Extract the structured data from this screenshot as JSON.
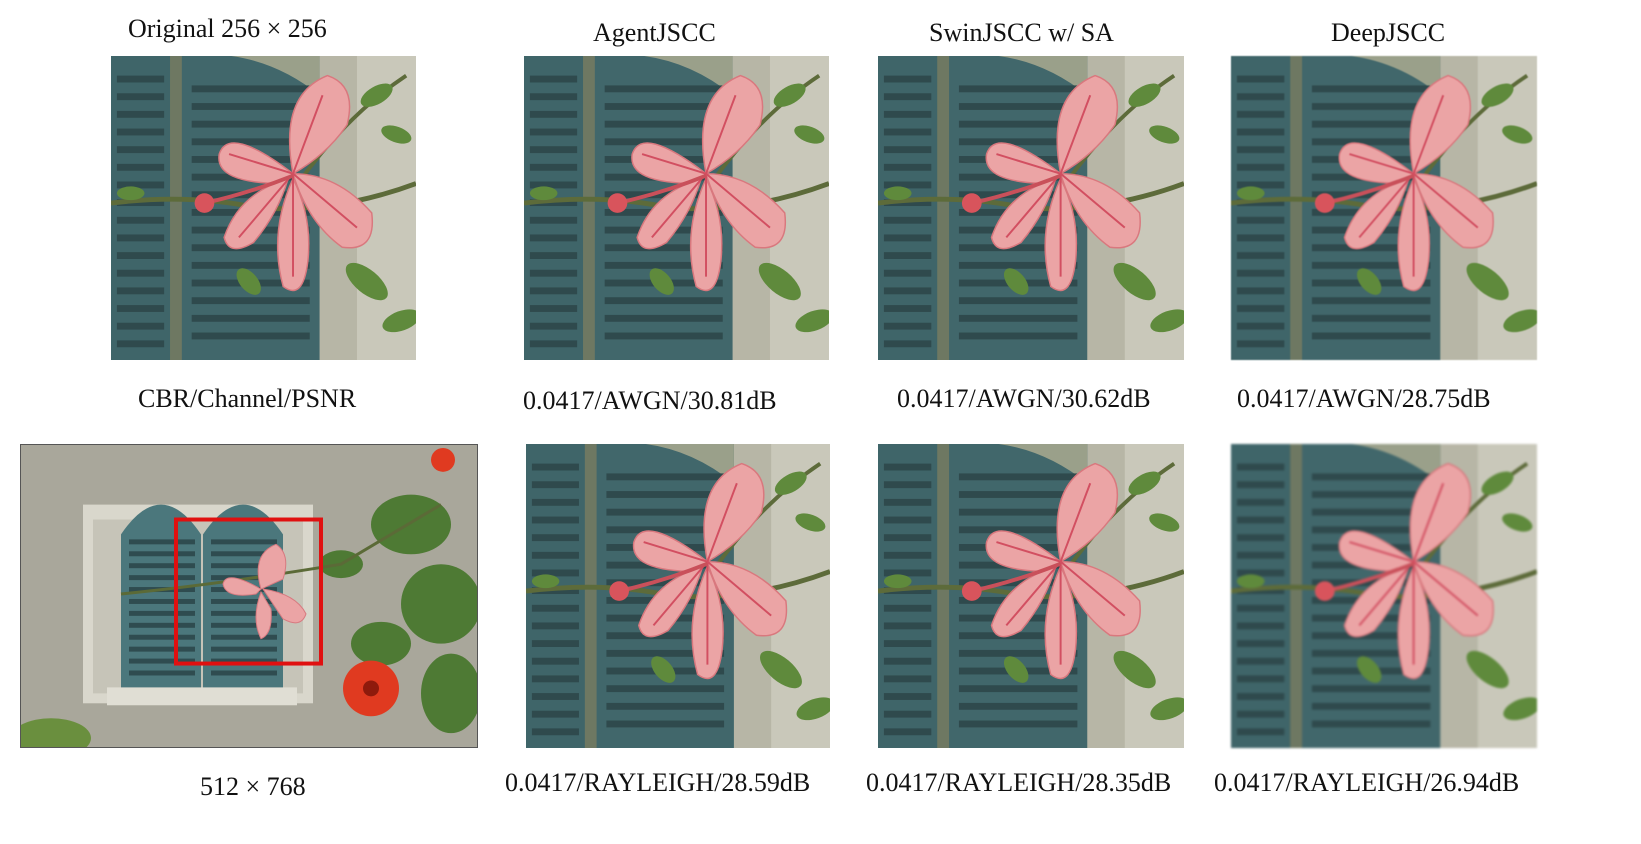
{
  "figure": {
    "top_row": {
      "original_title": "Original  256 × 256",
      "method_titles": [
        "AgentJSCC",
        "SwinJSCC w/ SA",
        "DeepJSCC"
      ]
    },
    "middle_row": {
      "legend_label": "CBR/Channel/PSNR",
      "awgn_results": [
        "0.0417/AWGN/30.81dB",
        "0.0417/AWGN/30.62dB",
        "0.0417/AWGN/28.75dB"
      ]
    },
    "bottom_row": {
      "full_image_size": "512 × 768",
      "rayleigh_results": [
        "0.0417/RAYLEIGH/28.59dB",
        "0.0417/RAYLEIGH/28.35dB",
        "0.0417/RAYLEIGH/26.94dB"
      ]
    },
    "colors": {
      "crop_box": "#e01010",
      "shutter": "#4f7b80",
      "petal": "#e9a0a3",
      "wall": "#b8b7a8"
    }
  }
}
